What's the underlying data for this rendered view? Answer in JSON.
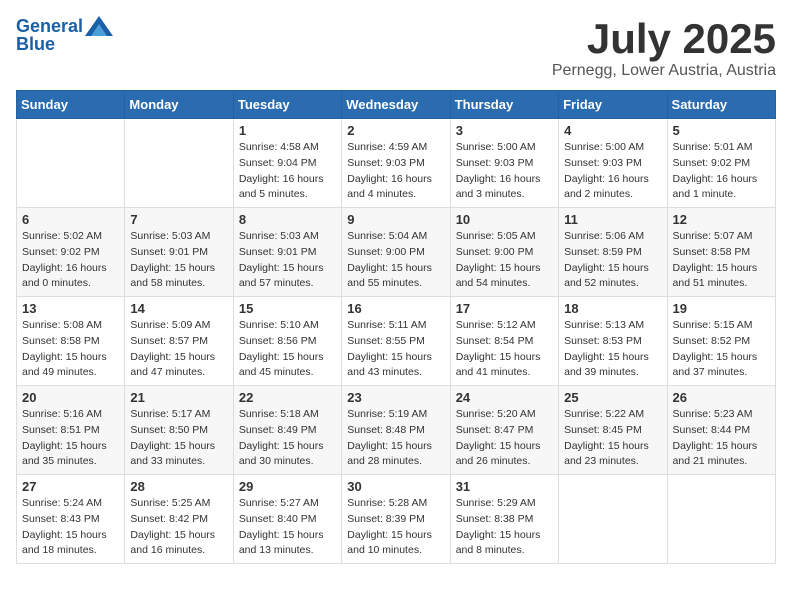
{
  "logo": {
    "line1": "General",
    "line2": "Blue"
  },
  "title": "July 2025",
  "location": "Pernegg, Lower Austria, Austria",
  "weekdays": [
    "Sunday",
    "Monday",
    "Tuesday",
    "Wednesday",
    "Thursday",
    "Friday",
    "Saturday"
  ],
  "weeks": [
    [
      {
        "day": "",
        "info": ""
      },
      {
        "day": "",
        "info": ""
      },
      {
        "day": "1",
        "info": "Sunrise: 4:58 AM\nSunset: 9:04 PM\nDaylight: 16 hours and 5 minutes."
      },
      {
        "day": "2",
        "info": "Sunrise: 4:59 AM\nSunset: 9:03 PM\nDaylight: 16 hours and 4 minutes."
      },
      {
        "day": "3",
        "info": "Sunrise: 5:00 AM\nSunset: 9:03 PM\nDaylight: 16 hours and 3 minutes."
      },
      {
        "day": "4",
        "info": "Sunrise: 5:00 AM\nSunset: 9:03 PM\nDaylight: 16 hours and 2 minutes."
      },
      {
        "day": "5",
        "info": "Sunrise: 5:01 AM\nSunset: 9:02 PM\nDaylight: 16 hours and 1 minute."
      }
    ],
    [
      {
        "day": "6",
        "info": "Sunrise: 5:02 AM\nSunset: 9:02 PM\nDaylight: 16 hours and 0 minutes."
      },
      {
        "day": "7",
        "info": "Sunrise: 5:03 AM\nSunset: 9:01 PM\nDaylight: 15 hours and 58 minutes."
      },
      {
        "day": "8",
        "info": "Sunrise: 5:03 AM\nSunset: 9:01 PM\nDaylight: 15 hours and 57 minutes."
      },
      {
        "day": "9",
        "info": "Sunrise: 5:04 AM\nSunset: 9:00 PM\nDaylight: 15 hours and 55 minutes."
      },
      {
        "day": "10",
        "info": "Sunrise: 5:05 AM\nSunset: 9:00 PM\nDaylight: 15 hours and 54 minutes."
      },
      {
        "day": "11",
        "info": "Sunrise: 5:06 AM\nSunset: 8:59 PM\nDaylight: 15 hours and 52 minutes."
      },
      {
        "day": "12",
        "info": "Sunrise: 5:07 AM\nSunset: 8:58 PM\nDaylight: 15 hours and 51 minutes."
      }
    ],
    [
      {
        "day": "13",
        "info": "Sunrise: 5:08 AM\nSunset: 8:58 PM\nDaylight: 15 hours and 49 minutes."
      },
      {
        "day": "14",
        "info": "Sunrise: 5:09 AM\nSunset: 8:57 PM\nDaylight: 15 hours and 47 minutes."
      },
      {
        "day": "15",
        "info": "Sunrise: 5:10 AM\nSunset: 8:56 PM\nDaylight: 15 hours and 45 minutes."
      },
      {
        "day": "16",
        "info": "Sunrise: 5:11 AM\nSunset: 8:55 PM\nDaylight: 15 hours and 43 minutes."
      },
      {
        "day": "17",
        "info": "Sunrise: 5:12 AM\nSunset: 8:54 PM\nDaylight: 15 hours and 41 minutes."
      },
      {
        "day": "18",
        "info": "Sunrise: 5:13 AM\nSunset: 8:53 PM\nDaylight: 15 hours and 39 minutes."
      },
      {
        "day": "19",
        "info": "Sunrise: 5:15 AM\nSunset: 8:52 PM\nDaylight: 15 hours and 37 minutes."
      }
    ],
    [
      {
        "day": "20",
        "info": "Sunrise: 5:16 AM\nSunset: 8:51 PM\nDaylight: 15 hours and 35 minutes."
      },
      {
        "day": "21",
        "info": "Sunrise: 5:17 AM\nSunset: 8:50 PM\nDaylight: 15 hours and 33 minutes."
      },
      {
        "day": "22",
        "info": "Sunrise: 5:18 AM\nSunset: 8:49 PM\nDaylight: 15 hours and 30 minutes."
      },
      {
        "day": "23",
        "info": "Sunrise: 5:19 AM\nSunset: 8:48 PM\nDaylight: 15 hours and 28 minutes."
      },
      {
        "day": "24",
        "info": "Sunrise: 5:20 AM\nSunset: 8:47 PM\nDaylight: 15 hours and 26 minutes."
      },
      {
        "day": "25",
        "info": "Sunrise: 5:22 AM\nSunset: 8:45 PM\nDaylight: 15 hours and 23 minutes."
      },
      {
        "day": "26",
        "info": "Sunrise: 5:23 AM\nSunset: 8:44 PM\nDaylight: 15 hours and 21 minutes."
      }
    ],
    [
      {
        "day": "27",
        "info": "Sunrise: 5:24 AM\nSunset: 8:43 PM\nDaylight: 15 hours and 18 minutes."
      },
      {
        "day": "28",
        "info": "Sunrise: 5:25 AM\nSunset: 8:42 PM\nDaylight: 15 hours and 16 minutes."
      },
      {
        "day": "29",
        "info": "Sunrise: 5:27 AM\nSunset: 8:40 PM\nDaylight: 15 hours and 13 minutes."
      },
      {
        "day": "30",
        "info": "Sunrise: 5:28 AM\nSunset: 8:39 PM\nDaylight: 15 hours and 10 minutes."
      },
      {
        "day": "31",
        "info": "Sunrise: 5:29 AM\nSunset: 8:38 PM\nDaylight: 15 hours and 8 minutes."
      },
      {
        "day": "",
        "info": ""
      },
      {
        "day": "",
        "info": ""
      }
    ]
  ]
}
